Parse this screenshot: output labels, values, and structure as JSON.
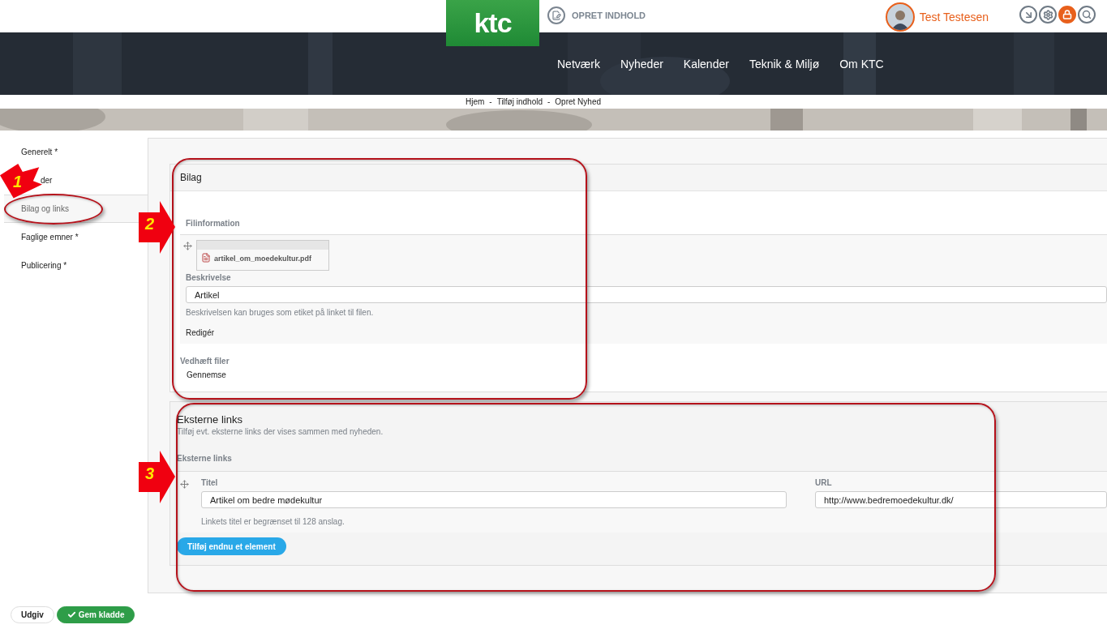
{
  "header": {
    "logo": "ktc",
    "create_link": "OPRET INDHOLD",
    "user_name": "Test Testesen",
    "tools": [
      {
        "kind": "arrow",
        "active": false
      },
      {
        "kind": "settings",
        "active": false
      },
      {
        "kind": "lock",
        "active": true
      },
      {
        "kind": "search",
        "active": false
      }
    ]
  },
  "nav": [
    "Netværk",
    "Nyheder",
    "Kalender",
    "Teknik & Miljø",
    "Om KTC"
  ],
  "breadcrumb": {
    "separator": "-",
    "items": [
      "Hjem",
      "Tilføj indhold",
      "Opret Nyhed"
    ]
  },
  "sidebar": {
    "items": [
      {
        "label": "Generelt *",
        "selected": false
      },
      {
        "label": "der",
        "selected": false
      },
      {
        "label": "Bilag og links",
        "selected": true
      },
      {
        "label": "Faglige emner *",
        "selected": false
      },
      {
        "label": "Publicering *",
        "selected": false
      }
    ]
  },
  "attachments": {
    "title": "Bilag",
    "file_info_label": "Filinformation",
    "file_name": "artikel_om_moedekultur.pdf",
    "description_label": "Beskrivelse",
    "description_value": "Artikel",
    "description_hint": "Beskrivelsen kan bruges som etiket på linket til filen.",
    "edit_link": "Redigér",
    "attach_label": "Vedhæft filer",
    "browse_button": "Gennemse"
  },
  "links": {
    "title": "Eksterne links",
    "subtitle": "Tilføj evt. eksterne links der vises sammen med nyheden.",
    "table_label": "Eksterne links",
    "rows": [
      {
        "title_label": "Titel",
        "title_value": "Artikel om bedre mødekultur",
        "title_hint": "Linkets titel er begrænset til 128 anslag.",
        "url_label": "URL",
        "url_value": "http://www.bedremoedekultur.dk/"
      }
    ],
    "add_button": "Tilføj endnu et element"
  },
  "actions": [
    {
      "label": "Udgiv",
      "kind": "plain"
    },
    {
      "label": "Gem kladde",
      "kind": "primary"
    }
  ],
  "annotations": [
    {
      "number": "1",
      "kind": "diagonal"
    },
    {
      "number": "2",
      "kind": "right"
    },
    {
      "number": "3",
      "kind": "right"
    }
  ]
}
